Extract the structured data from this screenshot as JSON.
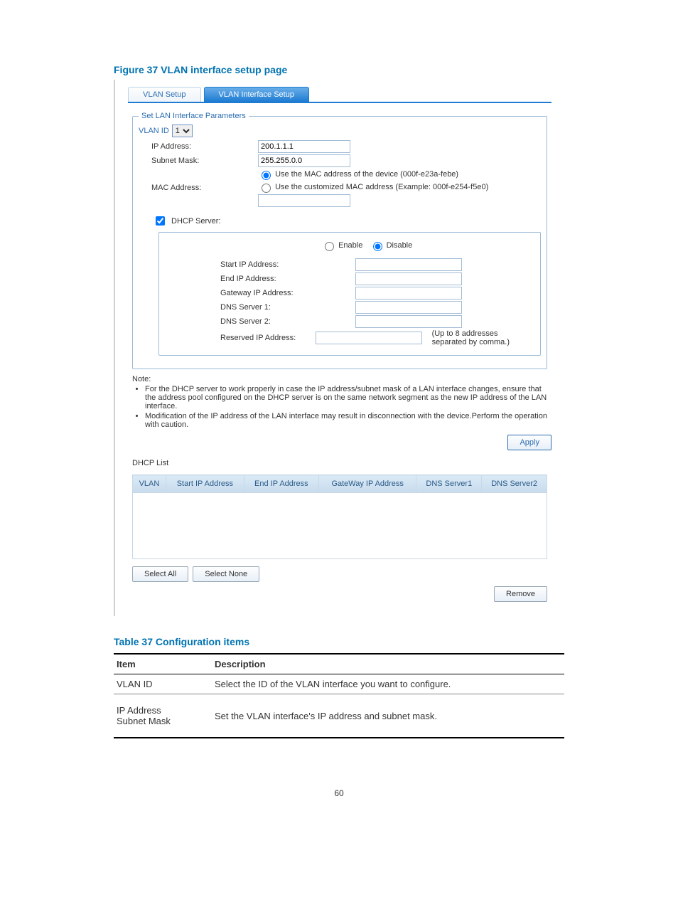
{
  "figure_title": "Figure 37 VLAN interface setup page",
  "tabs": {
    "vlan_setup": "VLAN Setup",
    "vlan_interface_setup": "VLAN Interface Setup"
  },
  "lan_params": {
    "legend": "Set LAN Interface Parameters",
    "vlan_id_label": "VLAN ID",
    "vlan_id_value": "1",
    "ip_address_label": "IP Address:",
    "ip_address_value": "200.1.1.1",
    "subnet_mask_label": "Subnet Mask:",
    "subnet_mask_value": "255.255.0.0",
    "mac_address_label": "MAC Address:",
    "mac_opt_device": "Use the MAC address of the device (000f-e23a-febe)",
    "mac_opt_custom": "Use the customized MAC address (Example: 000f-e254-f5e0)"
  },
  "dhcp": {
    "check_label": "DHCP Server:",
    "enable": "Enable",
    "disable": "Disable",
    "start_ip": "Start IP Address:",
    "end_ip": "End IP Address:",
    "gateway_ip": "Gateway IP Address:",
    "dns1": "DNS Server 1:",
    "dns2": "DNS Server 2:",
    "reserved_ip": "Reserved IP Address:",
    "reserved_hint": "(Up to 8 addresses separated by comma.)"
  },
  "note": {
    "heading": "Note:",
    "n1": "For the DHCP server to work properly in case the IP address/subnet mask of a LAN interface changes, ensure that the address pool configured on the DHCP server is on the same network segment as the new IP address of the LAN interface.",
    "n2": "Modification of the IP address of the LAN interface may result in disconnection with the device.Perform the operation with caution."
  },
  "apply_label": "Apply",
  "dhcp_list": {
    "title": "DHCP List",
    "cols": {
      "vlan": "VLAN",
      "start": "Start IP Address",
      "end": "End IP Address",
      "gateway": "GateWay IP Address",
      "dns1": "DNS Server1",
      "dns2": "DNS Server2"
    },
    "select_all": "Select All",
    "select_none": "Select None",
    "remove": "Remove"
  },
  "table_title": "Table 37 Configuration items",
  "config_table": {
    "head_item": "Item",
    "head_desc": "Description",
    "r1_item": "VLAN ID",
    "r1_desc": "Select the ID of the VLAN interface you want to configure.",
    "r2_item1": "IP Address",
    "r2_item2": "Subnet Mask",
    "r2_desc": "Set the VLAN interface's IP address and subnet mask."
  },
  "page_number": "60"
}
